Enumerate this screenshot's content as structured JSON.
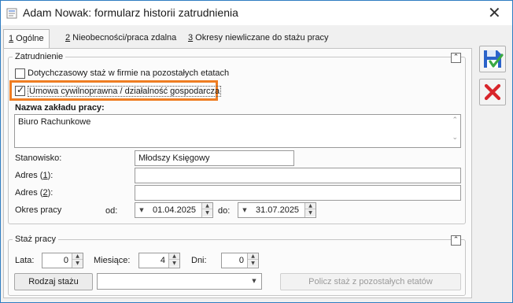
{
  "window": {
    "title": "Adam Nowak: formularz historii zatrudnienia",
    "close_glyph": "✕"
  },
  "tabs": [
    {
      "key": "1",
      "label": " Ogólne",
      "active": true
    },
    {
      "key": "2",
      "label": " Nieobecności/praca zdalna",
      "active": false
    },
    {
      "key": "3",
      "label": " Okresy niewliczane do stażu pracy",
      "active": false
    }
  ],
  "zatrudnienie": {
    "legend": "Zatrudnienie",
    "collapse_glyph": "⌃",
    "checkbox1": {
      "label": "Dotychczasowy staż w firmie na pozostałych etatach",
      "checked": false
    },
    "checkbox2": {
      "label": "Umowa cywilnoprawna / działalność gospodarcza",
      "checked": true,
      "check_glyph": "✓"
    },
    "employer_label": "Nazwa zakładu pracy:",
    "employer_value": "Biuro Rachunkowe",
    "position_label": "Stanowisko:",
    "position_value": "Młodszy Księgowy",
    "address1_label_pre": "Adres (",
    "address1_key": "1",
    "address1_label_post": "):",
    "address1_value": "",
    "address2_label_pre": "Adres (",
    "address2_key": "2",
    "address2_label_post": "):",
    "address2_value": "",
    "period_label": "Okres pracy",
    "from_label": "od:",
    "from_value": "01.04.2025",
    "to_label": "do:",
    "to_value": "31.07.2025"
  },
  "staz": {
    "legend": "Staż pracy",
    "collapse_glyph": "⌃",
    "years_label": "Lata:",
    "years_value": "0",
    "months_label": "Miesiące:",
    "months_value": "4",
    "days_label": "Dni:",
    "days_value": "0",
    "type_button": "Rodzaj stażu",
    "type_value": "",
    "calc_button": "Policz staż z pozostałych etatów"
  },
  "icons": {
    "spin_up": "▲",
    "spin_down": "▼",
    "date_arrow": "▼",
    "dropdown_arrow": "▼",
    "scroll_up": "⌃",
    "scroll_down": "⌄"
  },
  "colors": {
    "highlight": "#ef7d22",
    "save_blue": "#2a62c9",
    "save_check": "#3aa843",
    "cancel_red": "#d8252b"
  }
}
